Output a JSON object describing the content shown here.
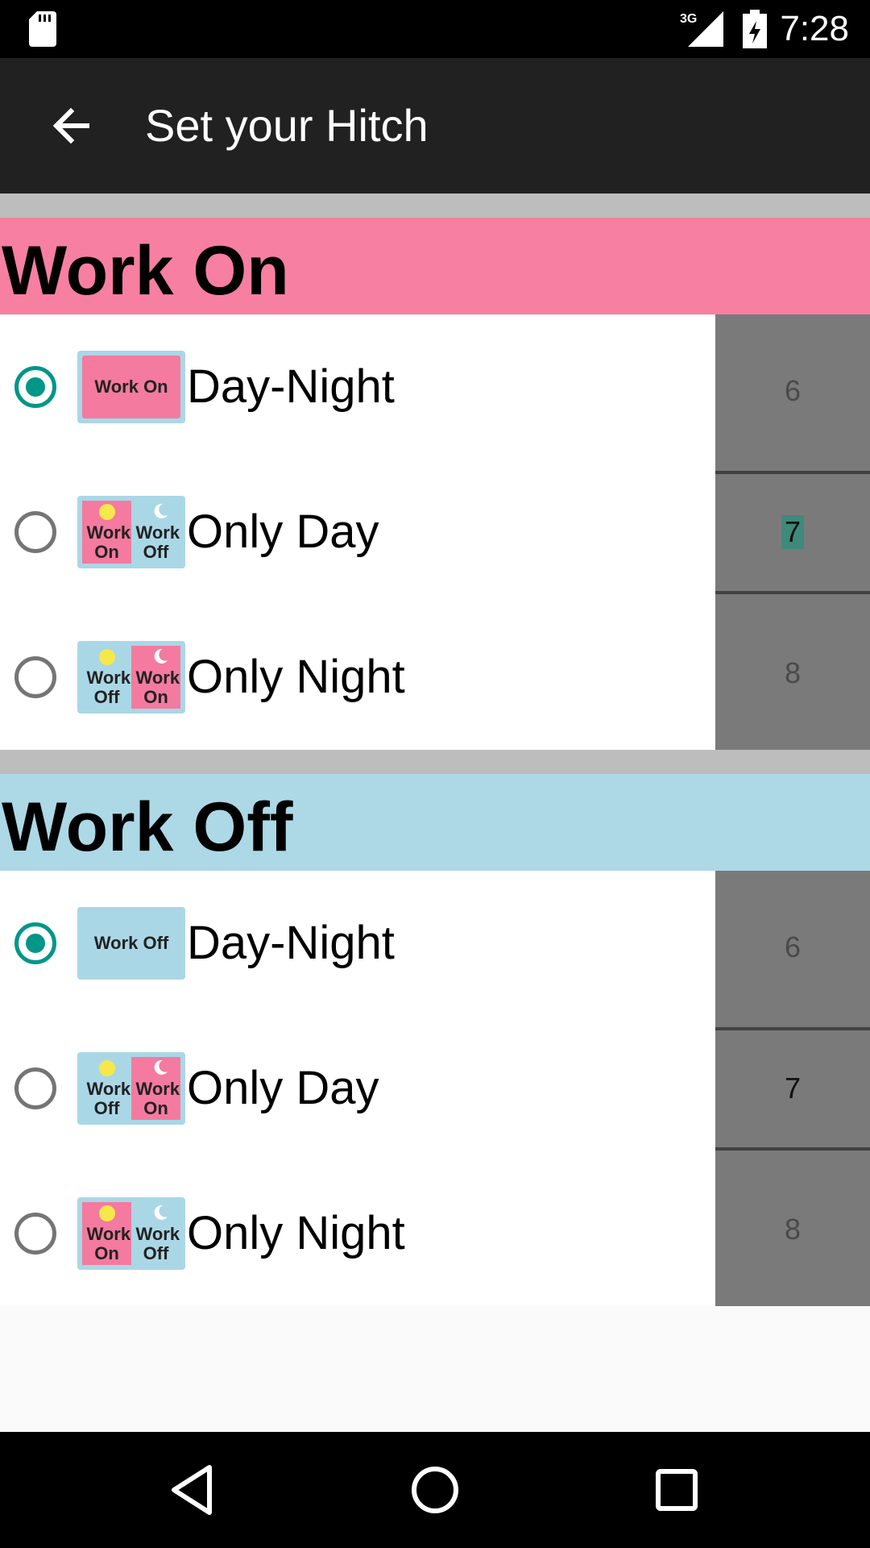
{
  "status_bar": {
    "time": "7:28",
    "network": "3G"
  },
  "app_bar": {
    "title": "Set your Hitch"
  },
  "sections": [
    {
      "title": "Work On",
      "color": "#f77fa2",
      "options": [
        {
          "label": "Day-Night",
          "checked": true,
          "thumb_text": "Work On"
        },
        {
          "label": "Only Day",
          "checked": false,
          "thumb_left": "Work On",
          "thumb_right": "Work Off"
        },
        {
          "label": "Only Night",
          "checked": false,
          "thumb_left": "Work Off",
          "thumb_right": "Work On"
        }
      ],
      "picker_values": [
        "6",
        "7",
        "8"
      ],
      "picker_selected": "7"
    },
    {
      "title": "Work Off",
      "color": "#add8e6",
      "options": [
        {
          "label": "Day-Night",
          "checked": true,
          "thumb_text": "Work Off"
        },
        {
          "label": "Only Day",
          "checked": false,
          "thumb_left": "Work Off",
          "thumb_right": "Work On"
        },
        {
          "label": "Only Night",
          "checked": false,
          "thumb_left": "Work On",
          "thumb_right": "Work Off"
        }
      ],
      "picker_values": [
        "6",
        "7",
        "8"
      ],
      "picker_selected": "7"
    }
  ],
  "icons": {
    "sd_card": "sd-card-icon",
    "signal": "signal-3g-icon",
    "battery": "battery-charging-icon",
    "back": "arrow-back-icon",
    "nav_back": "triangle-back-icon",
    "nav_home": "circle-home-icon",
    "nav_recents": "square-recents-icon"
  }
}
